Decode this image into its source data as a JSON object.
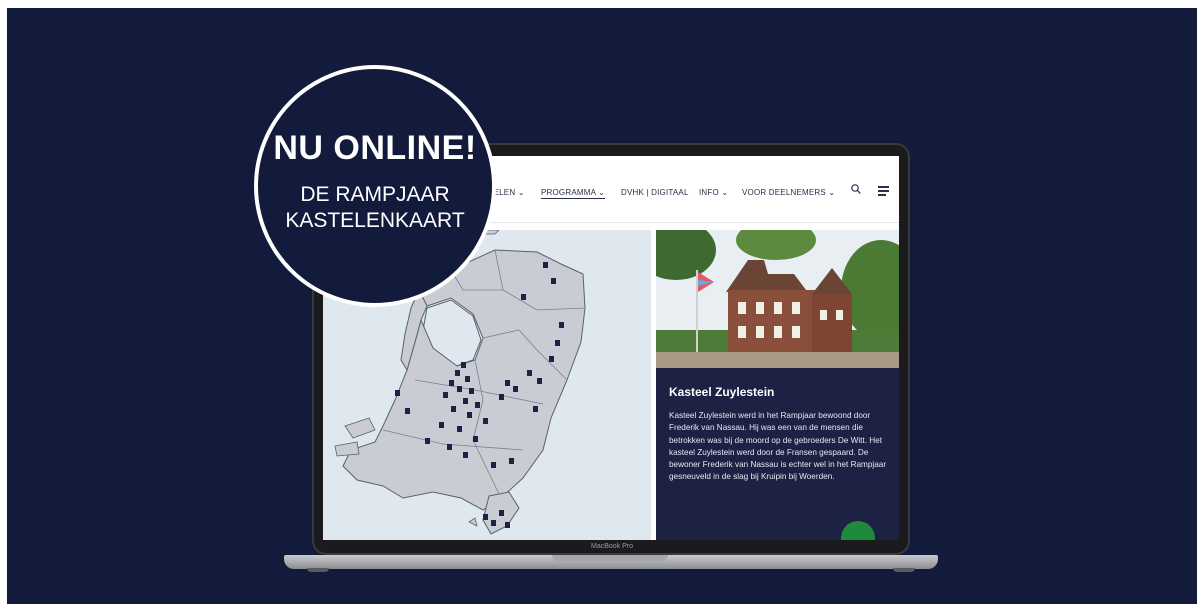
{
  "badge": {
    "headline": "NU ONLINE!",
    "line1": "DE RAMPJAAR",
    "line2": "KASTELENKAART"
  },
  "nav": {
    "items": [
      {
        "label": "STELEN ⌄"
      },
      {
        "label": "PROGRAMMA ⌄"
      },
      {
        "label": "DVHK | DIGITAAL"
      },
      {
        "label": "INFO ⌄"
      },
      {
        "label": "VOOR DEELNEMERS ⌄"
      }
    ]
  },
  "castle": {
    "name": "Kasteel Zuylestein",
    "description": "Kasteel Zuylestein werd in het Rampjaar bewoond door Frederik van Nassau. Hij was een van de mensen die betrokken was bij de moord op de gebroeders De Witt. Het kasteel Zuylestein werd door de Fransen gespaard. De bewoner Frederik van Nassau is echter wel in het Rampjaar gesneuveld in de slag bij Kruipin bij Woerden."
  },
  "laptop": {
    "brand": "MacBook Pro"
  },
  "colors": {
    "background": "#131b3c",
    "panel": "#1d2143",
    "accent": "#1f8a3c",
    "land": "#c9ccd2",
    "water": "#dfe8ef"
  }
}
